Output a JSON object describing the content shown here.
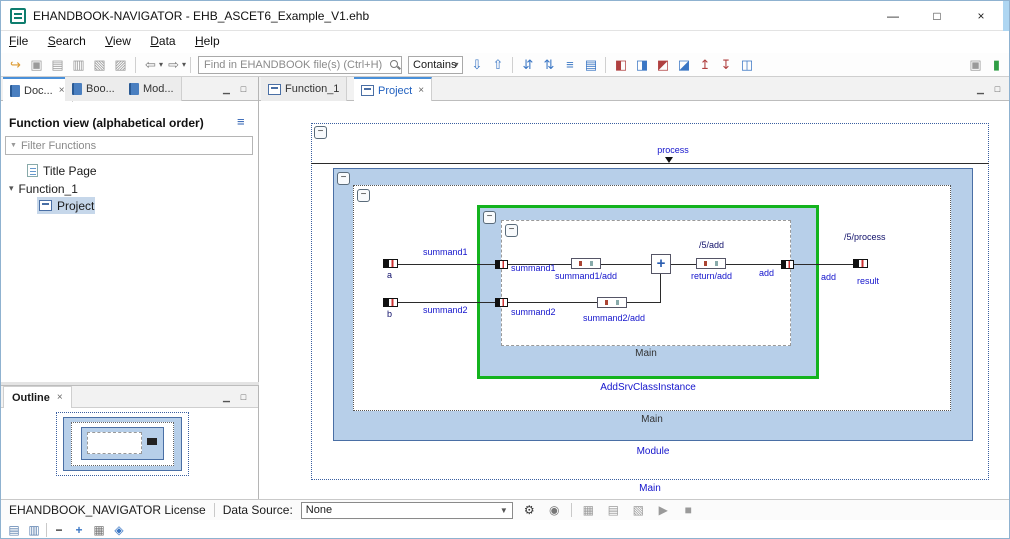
{
  "colors": {
    "label_blue": "#1414cc",
    "label_dark": "#10106a",
    "module_fill": "#b7cfe9",
    "selection_green": "#14b31e",
    "block_border": "#4a6fa5"
  },
  "window": {
    "title": "EHANDBOOK-NAVIGATOR - EHB_ASCET6_Example_V1.ehb",
    "minimize": "—",
    "maximize": "□",
    "close": "×"
  },
  "menu": {
    "items": [
      "File",
      "Search",
      "View",
      "Data",
      "Help"
    ]
  },
  "toolbar": {
    "search_placeholder": "Find in EHANDBOOK file(s) (Ctrl+H)",
    "contains": "Contains",
    "caret": "▾",
    "icons": {
      "import": "↪",
      "save": "▣",
      "print": "▤",
      "export": "▥",
      "copy": "▧",
      "paste": "▨",
      "back": "⇦",
      "forward": "⇨",
      "find_next": "⇩",
      "find_prev": "⇧",
      "expand_all": "⇵",
      "collapse_all": "⇅",
      "tree_view": "≡",
      "list_view": "▤",
      "link": "◧",
      "sync": "◨",
      "overlay": "◩",
      "pin": "◪",
      "goto_up": "↥",
      "goto_down": "↧",
      "compare": "◫",
      "window": "▣",
      "manual": "▮"
    }
  },
  "left_panel": {
    "tabs": [
      {
        "label": "Doc...",
        "close": "×"
      },
      {
        "label": "Boo..."
      },
      {
        "label": "Mod..."
      }
    ],
    "minimize": "▁",
    "maximize": "□",
    "function_view": {
      "header": "Function view (alphabetical order)",
      "menu_icon": "≡",
      "filter_placeholder": "Filter Functions",
      "funnel": "▼",
      "tree": [
        {
          "label": "Title Page"
        },
        {
          "label": "Function_1",
          "chevron": "▾"
        },
        {
          "label": "Project"
        }
      ]
    },
    "outline": {
      "title": "Outline",
      "close": "×",
      "minimize": "▁",
      "maximize": "□"
    }
  },
  "editor": {
    "tabs": [
      {
        "label": "Function_1"
      },
      {
        "label": "Project",
        "close": "×"
      }
    ],
    "minimize": "▁",
    "maximize": "□"
  },
  "diagram": {
    "collapse": "−",
    "process": "process",
    "outer_main": "Main",
    "module": "Module",
    "module_main": "Main",
    "instance": "AddSrvClassInstance",
    "instance_main": "Main",
    "a": "a",
    "b": "b",
    "summand1": "summand1",
    "summand2": "summand2",
    "summand1_add": "summand1/add",
    "summand2_add": "summand2/add",
    "return_add": "return/add",
    "five_add": "/5/add",
    "add": "add",
    "result": "result",
    "five_process": "/5/process",
    "plus": "+"
  },
  "statusbar": {
    "license": "EHANDBOOK_NAVIGATOR License",
    "data_source_label": "Data Source:",
    "data_source_value": "None",
    "caret": "▼",
    "icons": {
      "gear": "⚙",
      "eye": "◉",
      "grid": "▦",
      "table": "▤",
      "layout": "▧",
      "play": "▶",
      "stop": "■"
    }
  },
  "bottom_bar": {
    "icons": {
      "panel1": "▤",
      "panel2": "▥",
      "zoom_out": "−",
      "zoom_in": "+",
      "zoom_grid": "▦",
      "zoom_fit": "◈"
    }
  }
}
